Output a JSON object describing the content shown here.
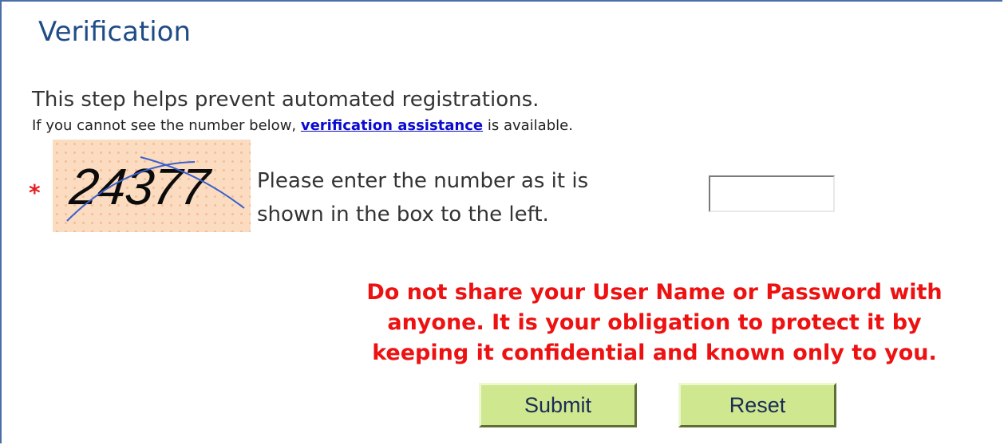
{
  "header": {
    "title": "Verification"
  },
  "intro": {
    "text": "This step helps prevent automated registrations.",
    "help_prefix": "If you cannot see the number below, ",
    "help_link": "verification assistance",
    "help_suffix": " is available."
  },
  "captcha": {
    "required_mark": "*",
    "value": "24377",
    "prompt_line1": "Please enter the number as it is",
    "prompt_line2": "shown in the box to the left.",
    "input_value": ""
  },
  "warning": {
    "line1": "Do not share your User Name or Password with",
    "line2": "anyone.  It is your obligation to protect it by",
    "line3": "keeping it confidential and known only to you."
  },
  "buttons": {
    "submit_label": "Submit",
    "reset_label": "Reset"
  },
  "colors": {
    "title": "#1f4c86",
    "warning": "#ee1111",
    "button_bg": "#cfe78e",
    "link": "#0a0ad0",
    "captcha_bg": "#fbdcc0"
  }
}
